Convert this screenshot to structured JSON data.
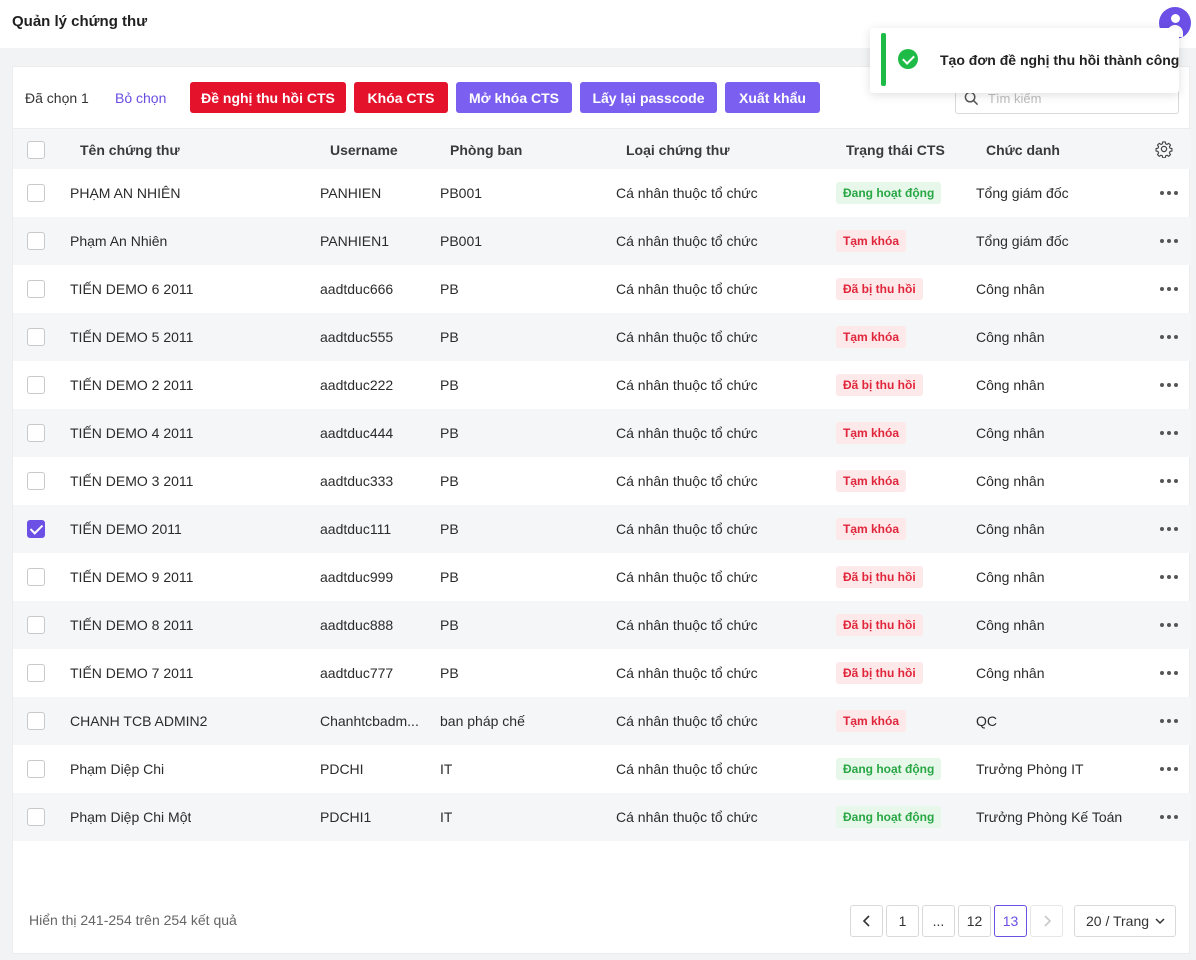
{
  "header": {
    "title": "Quản lý chứng thư",
    "avatar_icon": "user-icon"
  },
  "toolbar": {
    "selected_label": "Đã chọn 1",
    "clear_selection": "Bỏ chọn",
    "buttons": {
      "revoke": "Đề nghị thu hồi CTS",
      "lock": "Khóa CTS",
      "unlock": "Mở khóa CTS",
      "passcode": "Lấy lại passcode",
      "export": "Xuất khẩu"
    },
    "search_placeholder": "Tìm kiếm"
  },
  "table": {
    "columns": {
      "name": "Tên chứng thư",
      "username": "Username",
      "department": "Phòng ban",
      "type": "Loại chứng thư",
      "status": "Trạng thái CTS",
      "position": "Chức danh"
    },
    "rows": [
      {
        "name": "PHẠM AN NHIÊN",
        "username": "PANHIEN",
        "department": "PB001",
        "type": "Cá nhân thuộc tổ chức",
        "status": "Đang hoạt động",
        "status_kind": "active",
        "position": "Tổng giám đốc",
        "checked": false
      },
      {
        "name": "Phạm An Nhiên",
        "username": "PANHIEN1",
        "department": "PB001",
        "type": "Cá nhân thuộc tổ chức",
        "status": "Tạm khóa",
        "status_kind": "locked",
        "position": "Tổng giám đốc",
        "checked": false
      },
      {
        "name": "TIẾN DEMO 6 2011",
        "username": "aadtduc666",
        "department": "PB",
        "type": "Cá nhân thuộc tổ chức",
        "status": "Đã bị thu hồi",
        "status_kind": "revoked",
        "position": "Công nhân",
        "checked": false
      },
      {
        "name": "TIẾN DEMO 5 2011",
        "username": "aadtduc555",
        "department": "PB",
        "type": "Cá nhân thuộc tổ chức",
        "status": "Tạm khóa",
        "status_kind": "locked",
        "position": "Công nhân",
        "checked": false
      },
      {
        "name": "TIẾN DEMO 2 2011",
        "username": "aadtduc222",
        "department": "PB",
        "type": "Cá nhân thuộc tổ chức",
        "status": "Đã bị thu hồi",
        "status_kind": "revoked",
        "position": "Công nhân",
        "checked": false
      },
      {
        "name": "TIẾN DEMO 4 2011",
        "username": "aadtduc444",
        "department": "PB",
        "type": "Cá nhân thuộc tổ chức",
        "status": "Tạm khóa",
        "status_kind": "locked",
        "position": "Công nhân",
        "checked": false
      },
      {
        "name": "TIẾN DEMO 3 2011",
        "username": "aadtduc333",
        "department": "PB",
        "type": "Cá nhân thuộc tổ chức",
        "status": "Tạm khóa",
        "status_kind": "locked",
        "position": "Công nhân",
        "checked": false
      },
      {
        "name": "TIẾN DEMO 2011",
        "username": "aadtduc111",
        "department": "PB",
        "type": "Cá nhân thuộc tổ chức",
        "status": "Tạm khóa",
        "status_kind": "locked",
        "position": "Công nhân",
        "checked": true
      },
      {
        "name": "TIẾN DEMO 9 2011",
        "username": "aadtduc999",
        "department": "PB",
        "type": "Cá nhân thuộc tổ chức",
        "status": "Đã bị thu hồi",
        "status_kind": "revoked",
        "position": "Công nhân",
        "checked": false
      },
      {
        "name": "TIẾN DEMO 8 2011",
        "username": "aadtduc888",
        "department": "PB",
        "type": "Cá nhân thuộc tổ chức",
        "status": "Đã bị thu hồi",
        "status_kind": "revoked",
        "position": "Công nhân",
        "checked": false
      },
      {
        "name": "TIẾN DEMO 7 2011",
        "username": "aadtduc777",
        "department": "PB",
        "type": "Cá nhân thuộc tổ chức",
        "status": "Đã bị thu hồi",
        "status_kind": "revoked",
        "position": "Công nhân",
        "checked": false
      },
      {
        "name": "CHANH TCB ADMIN2",
        "username": "Chanhtcbadm...",
        "department": "ban pháp chế",
        "type": "Cá nhân thuộc tổ chức",
        "status": "Tạm khóa",
        "status_kind": "locked",
        "position": "QC",
        "checked": false
      },
      {
        "name": "Phạm Diệp Chi",
        "username": "PDCHI",
        "department": "IT",
        "type": "Cá nhân thuộc tổ chức",
        "status": "Đang hoạt động",
        "status_kind": "active",
        "position": "Trưởng Phòng IT",
        "checked": false
      },
      {
        "name": "Phạm Diệp Chi Một",
        "username": "PDCHI1",
        "department": "IT",
        "type": "Cá nhân thuộc tổ chức",
        "status": "Đang hoạt động",
        "status_kind": "active",
        "position": "Trưởng Phòng Kế Toán",
        "checked": false
      }
    ]
  },
  "footer": {
    "summary": "Hiển thị 241-254 trên 254 kết quả",
    "pages": [
      "1",
      "...",
      "12",
      "13"
    ],
    "current_page": "13",
    "page_size": "20 / Trang"
  },
  "toast": {
    "message": "Tạo đơn đề nghị thu hồi thành công",
    "icon": "check-circle-icon"
  },
  "colors": {
    "primary": "#7b5ff0",
    "danger": "#e5122c",
    "success": "#1fbb47"
  }
}
